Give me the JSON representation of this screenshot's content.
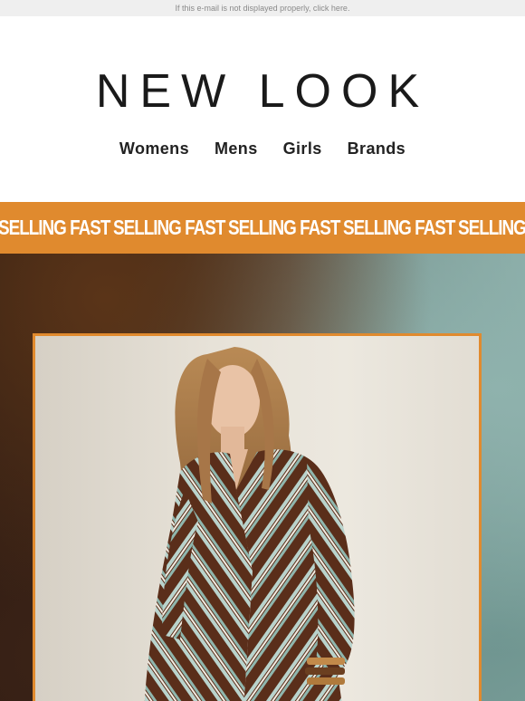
{
  "preheader": {
    "text": "If this e-mail is not displayed properly, click here."
  },
  "brand": {
    "logo_text": "NEW LOOK"
  },
  "nav": {
    "items": [
      {
        "label": "Womens"
      },
      {
        "label": "Mens"
      },
      {
        "label": "Girls"
      },
      {
        "label": "Brands"
      }
    ]
  },
  "ticker": {
    "items": [
      "SELLING FAST",
      "SELLING FAST",
      "SELLING FAST",
      "SELLING FAST",
      "SELLING FAST"
    ]
  },
  "colors": {
    "accent": "#e08a2e",
    "text_dark": "#222222",
    "preheader_bg": "#efefef"
  },
  "hero": {
    "image_icon": "model-photo-striped-wrap-dress"
  }
}
